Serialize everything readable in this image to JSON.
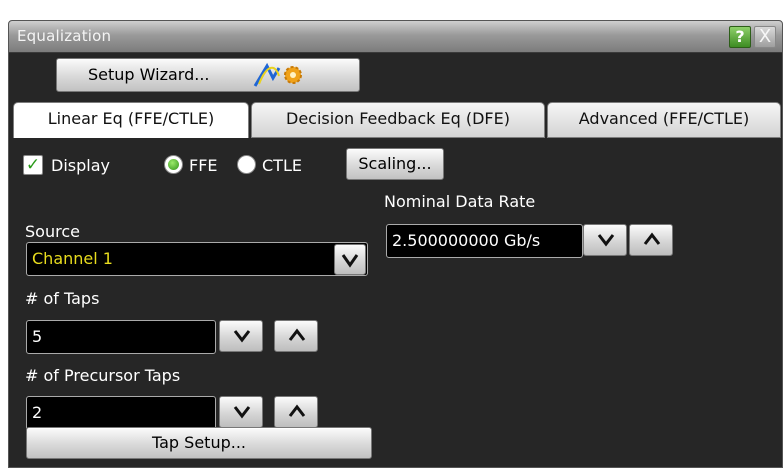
{
  "window": {
    "title": "Equalization",
    "help_label": "?",
    "close_label": "X"
  },
  "toolbar": {
    "wizard_label": "Setup Wizard..."
  },
  "tabs": [
    {
      "label": "Linear Eq (FFE/CTLE)",
      "active": true
    },
    {
      "label": "Decision Feedback Eq (DFE)",
      "active": false
    },
    {
      "label": "Advanced (FFE/CTLE)",
      "active": false
    }
  ],
  "display": {
    "checkbox_mark": "✓",
    "checkbox_label": "Display",
    "checked": true,
    "mode_options": [
      "FFE",
      "CTLE"
    ],
    "mode_selected": "FFE",
    "scaling_label": "Scaling..."
  },
  "source": {
    "label": "Source",
    "value": "Channel 1"
  },
  "taps": {
    "label": "# of Taps",
    "value": "5"
  },
  "precursor": {
    "label": "# of Precursor Taps",
    "value": "2"
  },
  "datarate": {
    "label": "Nominal Data Rate",
    "value": "2.500000000 Gb/s"
  },
  "tap_setup_label": "Tap Setup...",
  "colors": {
    "panel_bg": "#262626",
    "source_text": "#e8dc1e",
    "radio_on": "#2f9318",
    "check": "#2a9a1a"
  }
}
